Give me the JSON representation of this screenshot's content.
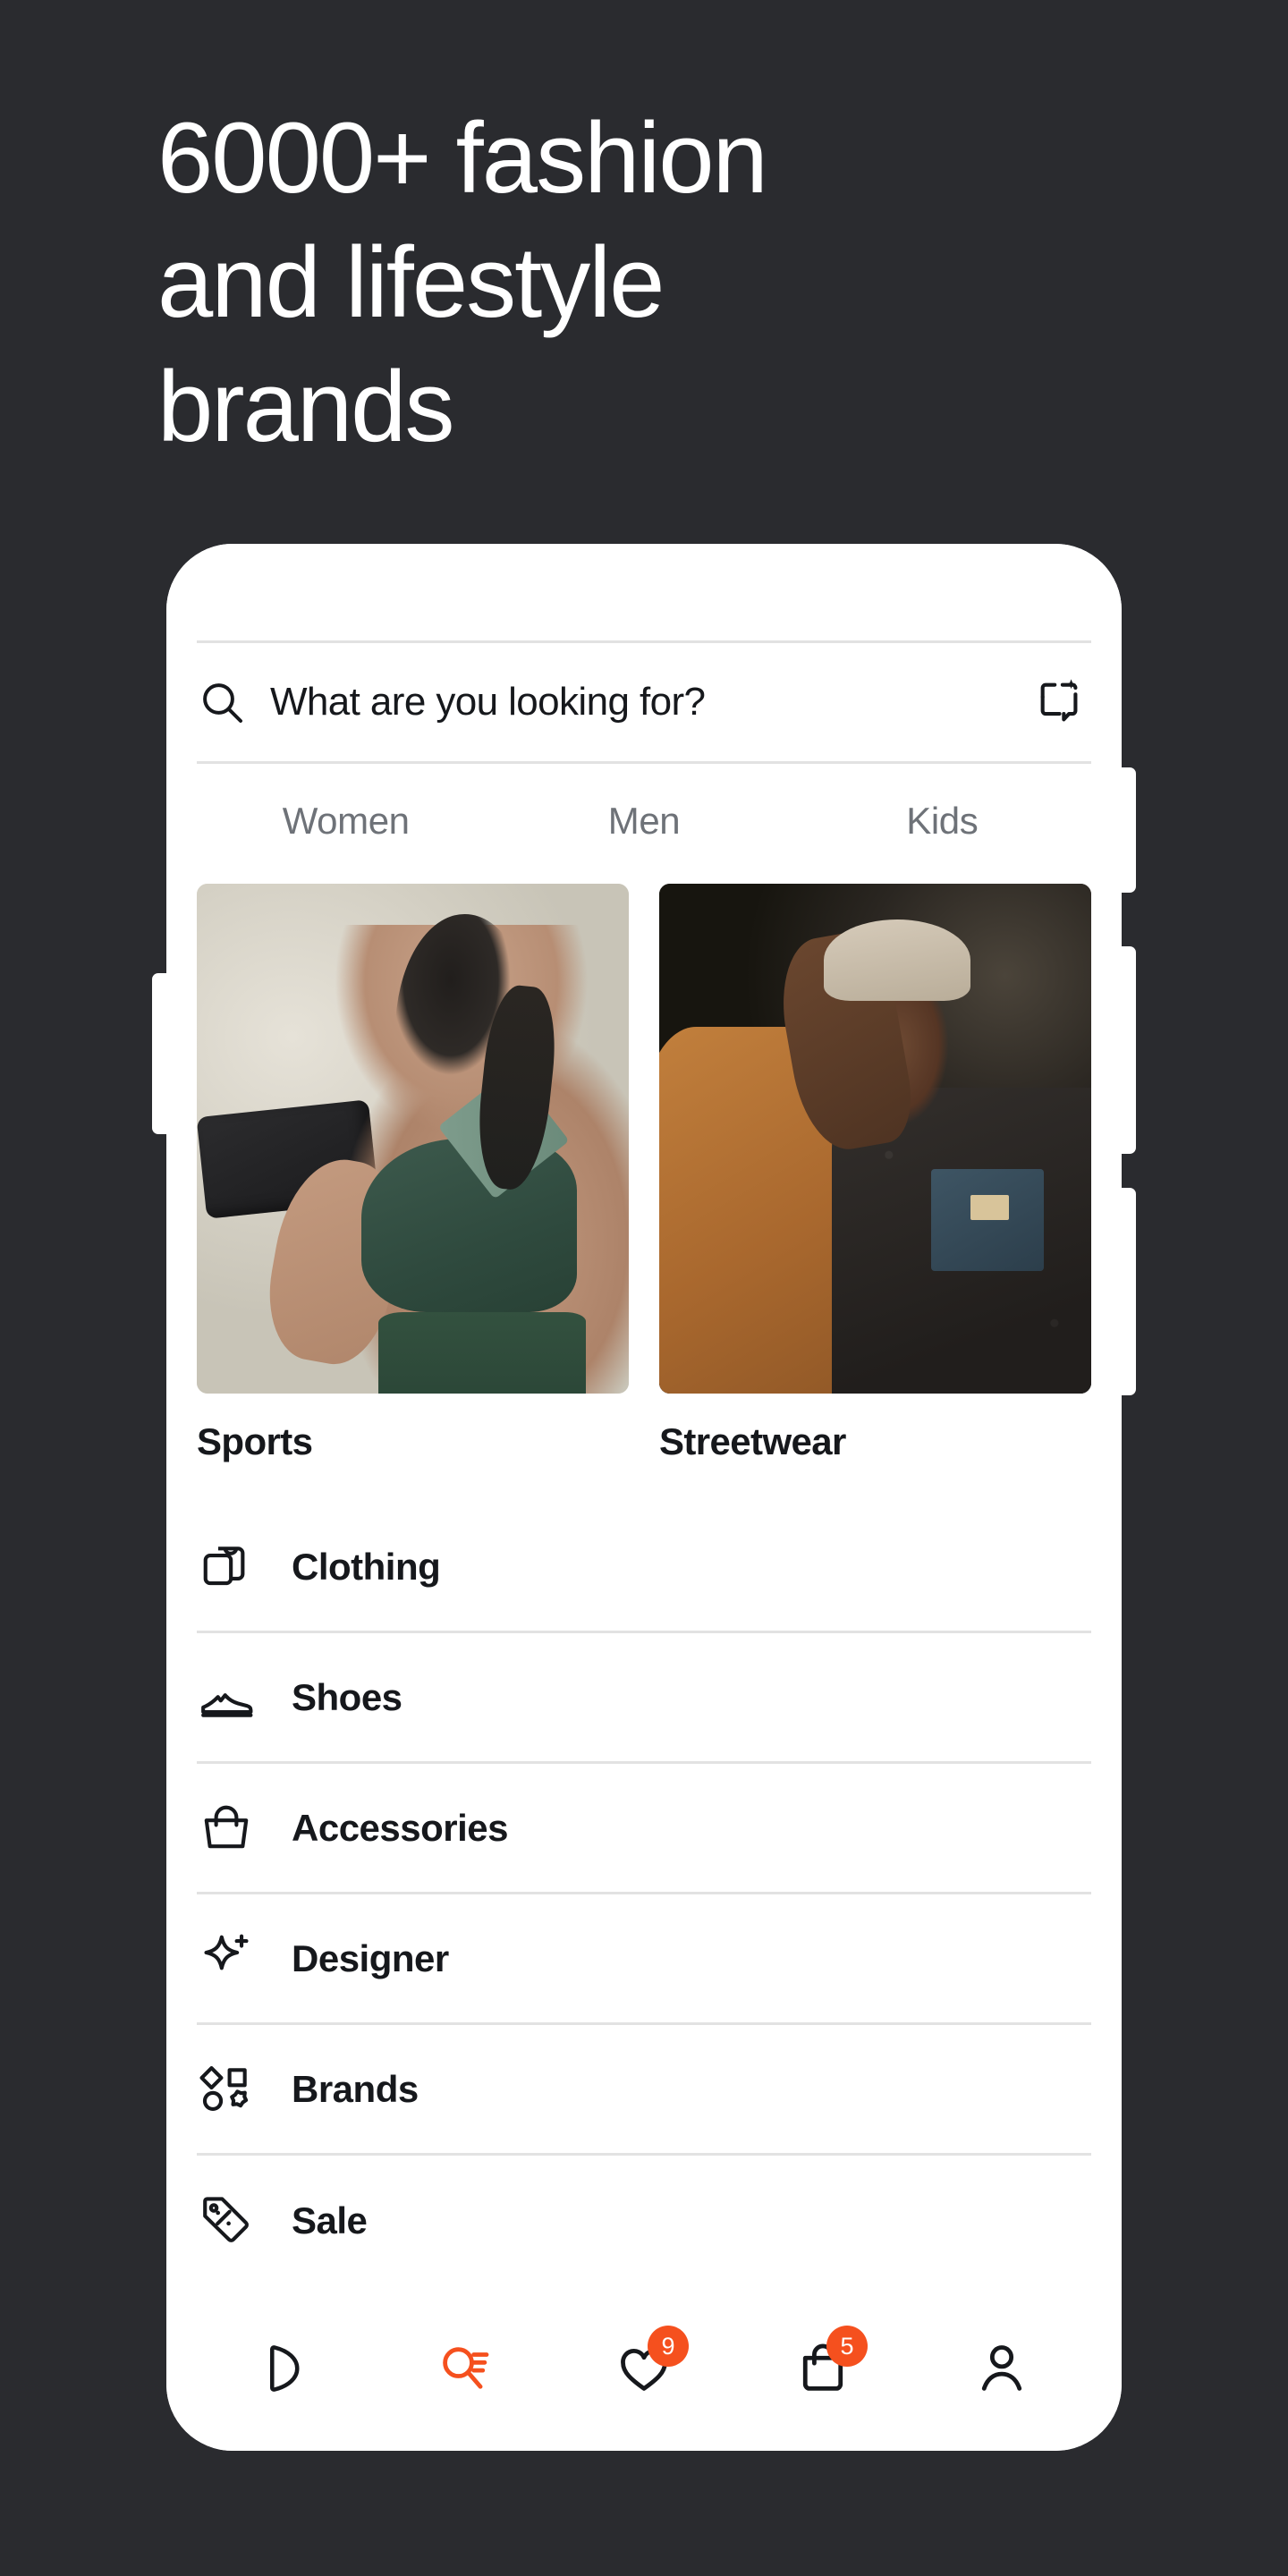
{
  "theme": {
    "background": "#2A2B2F",
    "surface": "#FFFFFF",
    "text_primary": "#16181C",
    "text_muted": "#6E7278",
    "accent": "#F5501E",
    "divider": "#E2E2E2"
  },
  "headline": {
    "line1": "6000+ fashion",
    "line2": "and lifestyle",
    "line3": "brands"
  },
  "search": {
    "placeholder": "What are you looking for?",
    "value": "",
    "search_icon": "search-icon",
    "lens_icon": "visual-search-icon"
  },
  "tabs": [
    {
      "label": "Women",
      "active": false
    },
    {
      "label": "Men",
      "active": false
    },
    {
      "label": "Kids",
      "active": false
    }
  ],
  "tiles": [
    {
      "label": "Sports",
      "image": "woman-lifting-dumbbell-green-sportswear"
    },
    {
      "label": "Streetwear",
      "image": "man-in-sherpa-jacket-and-cap"
    }
  ],
  "list": [
    {
      "label": "Clothing",
      "icon": "tshirt-stack-icon"
    },
    {
      "label": "Shoes",
      "icon": "sneaker-icon"
    },
    {
      "label": "Accessories",
      "icon": "handbag-icon"
    },
    {
      "label": "Designer",
      "icon": "sparkle-plus-icon"
    },
    {
      "label": "Brands",
      "icon": "shapes-grid-icon"
    },
    {
      "label": "Sale",
      "icon": "price-tag-percent-icon"
    }
  ],
  "bottom_nav": [
    {
      "name": "home",
      "icon": "home-pick-icon",
      "active": false,
      "badge": ""
    },
    {
      "name": "search",
      "icon": "search-list-icon",
      "active": true,
      "badge": ""
    },
    {
      "name": "saved",
      "icon": "heart-icon",
      "active": false,
      "badge": "9"
    },
    {
      "name": "bag",
      "icon": "shopping-bag-icon",
      "active": false,
      "badge": "5"
    },
    {
      "name": "profile",
      "icon": "person-icon",
      "active": false,
      "badge": ""
    }
  ]
}
